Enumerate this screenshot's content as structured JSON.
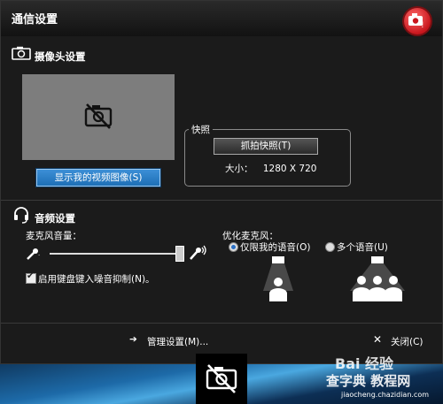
{
  "window": {
    "title": "通信设置"
  },
  "camera": {
    "section_title": "摄像头设置",
    "show_video_button": "显示我的视频图像(S)",
    "snapshot_legend": "快照",
    "snapshot_button": "抓拍快照(T)",
    "size_label": "大小：",
    "size_value": "1280 X 720"
  },
  "audio": {
    "section_title": "音频设置",
    "mic_volume_label": "麦克风音量：",
    "mic_volume_level": 0.97,
    "noise_suppression_label": "启用键盘键入噪音抑制(N)。",
    "noise_suppression_checked": true,
    "optimize_label": "优化麦克风：",
    "option_my_voice": "仅限我的语音(O)",
    "option_multiple": "多个语音(U)",
    "selected_option": "仅限我的语音(O)"
  },
  "footer": {
    "manage_settings": "管理设置(M)...",
    "close": "关闭(C)"
  },
  "watermark": {
    "line1": "Bai 经验",
    "line2": "查字典 教程网",
    "line3": "jiaocheng.chazidian.com"
  },
  "colors": {
    "accent": "#2a7ccc",
    "badge": "#c8161d"
  }
}
